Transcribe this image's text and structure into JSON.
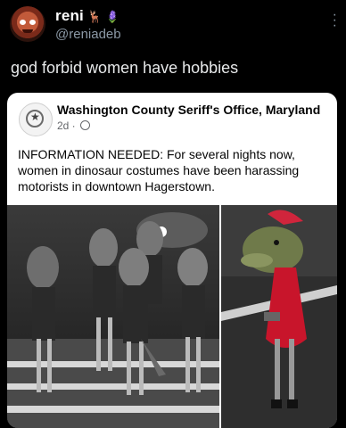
{
  "tweet": {
    "display_name": "reni",
    "emoji": "🦌 🪻",
    "handle": "@reniadeb",
    "text": "god forbid women have hobbies"
  },
  "post": {
    "page_name": "Washington County Seriff's Office, Maryland",
    "time": "2d ·",
    "body": "INFORMATION NEEDED: For several nights now, women in dinosaur costumes have been harassing motorists in downtown Hagerstown."
  },
  "icons": [
    "avatar",
    "more-options-icon",
    "sheriff-seal-logo",
    "globe-icon"
  ]
}
